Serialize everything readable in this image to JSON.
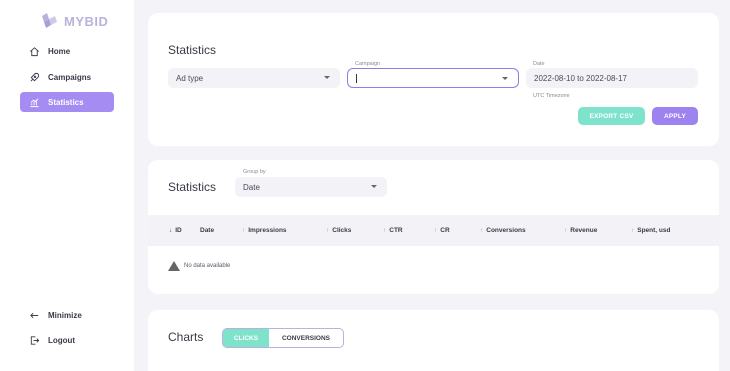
{
  "brand": {
    "name": "MYBID"
  },
  "sidebar": {
    "items": [
      {
        "label": "Home",
        "icon": "home-icon"
      },
      {
        "label": "Campaigns",
        "icon": "rocket-icon"
      },
      {
        "label": "Statistics",
        "icon": "chart-icon",
        "active": true
      }
    ],
    "bottom": [
      {
        "label": "Minimize",
        "icon": "arrow-left-icon"
      },
      {
        "label": "Logout",
        "icon": "logout-icon"
      }
    ]
  },
  "filters": {
    "title": "Statistics",
    "ad_type": {
      "value": "Ad type"
    },
    "campaign": {
      "label": "Campaign",
      "value": ""
    },
    "date": {
      "label": "Date",
      "value": "2022-08-10 to 2022-08-17",
      "hint": "UTC Timezone"
    },
    "export_label": "EXPORT CSV",
    "apply_label": "APPLY"
  },
  "stats": {
    "title": "Statistics",
    "group_by": {
      "label": "Group by",
      "value": "Date"
    },
    "columns": [
      "ID",
      "Date",
      "Impressions",
      "Clicks",
      "CTR",
      "CR",
      "Conversions",
      "Revenue",
      "Spent, usd"
    ],
    "empty_text": "No data available"
  },
  "charts": {
    "title": "Charts",
    "tabs": [
      {
        "label": "CLICKS",
        "active": true
      },
      {
        "label": "CONVERSIONS",
        "active": false
      }
    ]
  },
  "colors": {
    "accent_purple": "#a48cf2",
    "accent_mint": "#7fe3cc",
    "background": "#f4f4f8"
  }
}
